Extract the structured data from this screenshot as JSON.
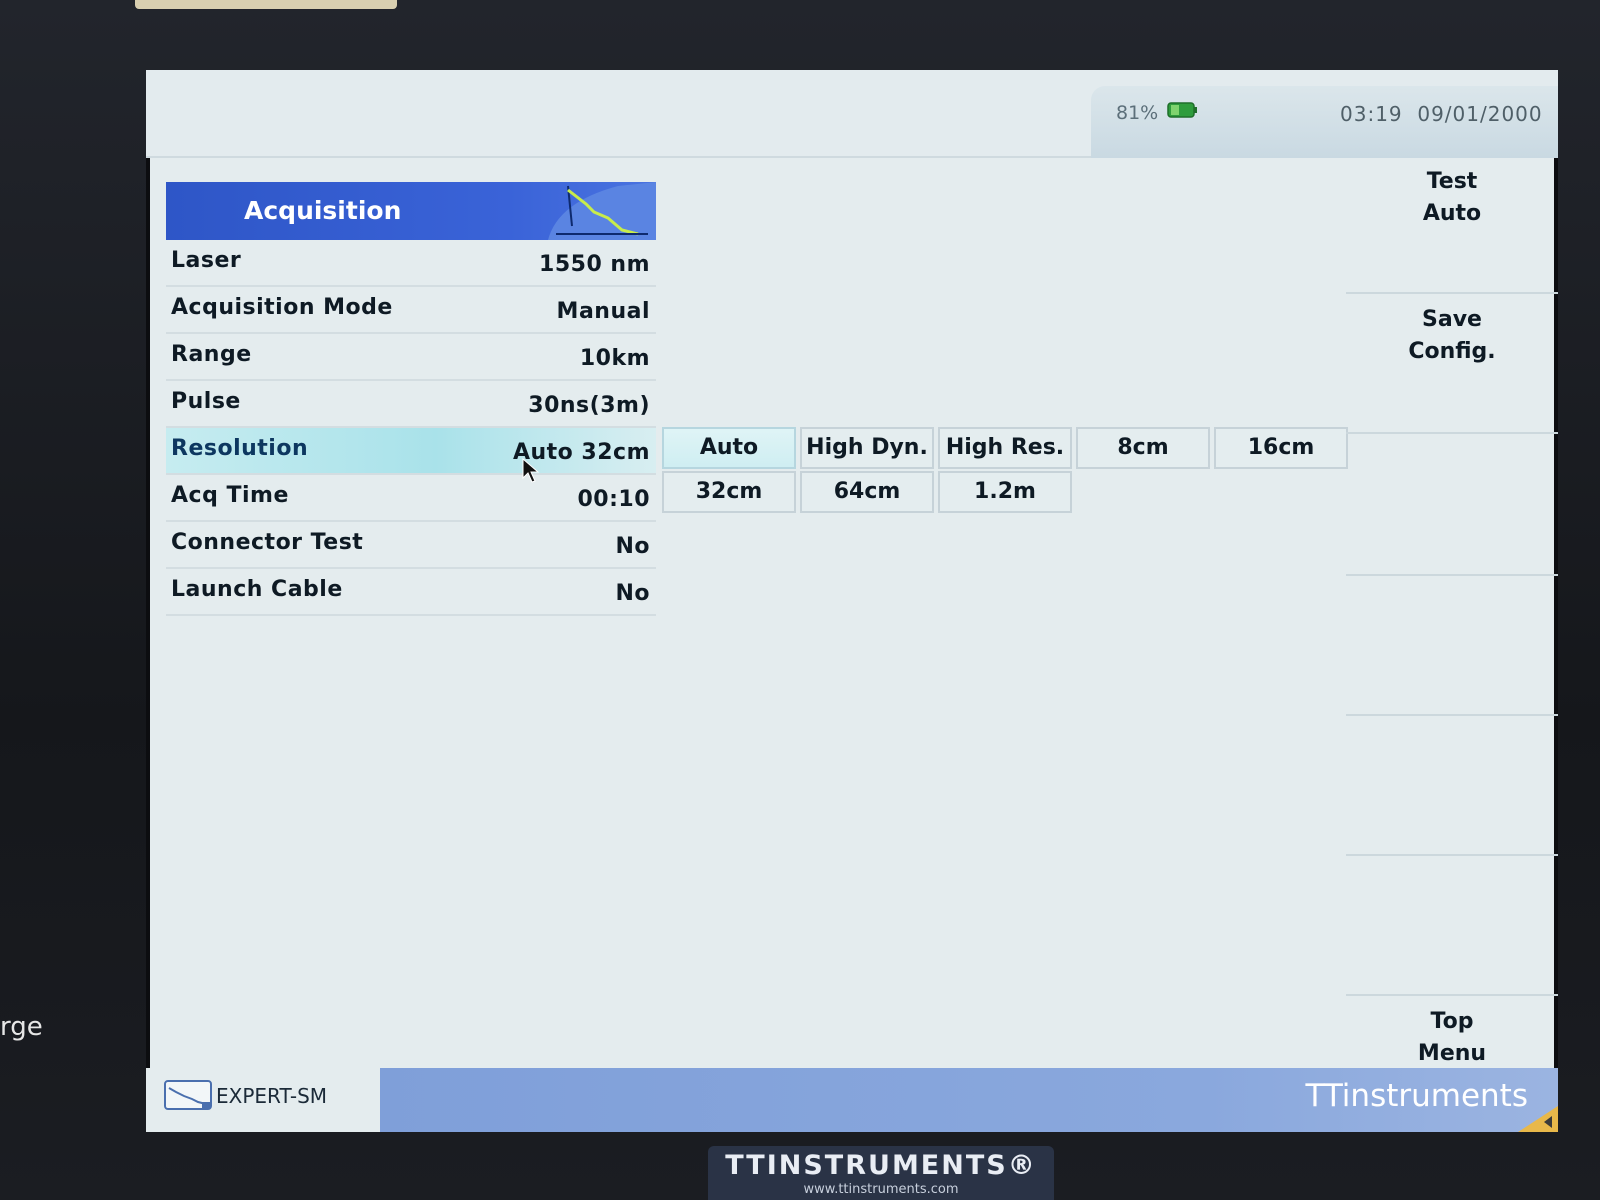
{
  "status": {
    "battery_percent": "81%",
    "time": "03:19",
    "date": "09/01/2000"
  },
  "panel": {
    "title": "Acquisition",
    "rows": [
      {
        "label": "Laser",
        "value": "1550 nm"
      },
      {
        "label": "Acquisition Mode",
        "value": "Manual"
      },
      {
        "label": "Range",
        "value": "10km"
      },
      {
        "label": "Pulse",
        "value": "30ns(3m)"
      },
      {
        "label": "Resolution",
        "value": "Auto 32cm"
      },
      {
        "label": "Acq Time",
        "value": "00:10"
      },
      {
        "label": "Connector Test",
        "value": "No"
      },
      {
        "label": "Launch Cable",
        "value": "No"
      }
    ]
  },
  "resolution_options": [
    "Auto",
    "High Dyn.",
    "High Res.",
    "8cm",
    "16cm",
    "32cm",
    "64cm",
    "1.2m"
  ],
  "softkeys": {
    "test_auto": {
      "line1": "Test",
      "line2": "Auto"
    },
    "save_config": {
      "line1": "Save",
      "line2": "Config."
    },
    "top_menu": {
      "line1": "Top",
      "line2": "Menu"
    }
  },
  "footer": {
    "mode": "EXPERT-SM",
    "brand": "TTinstruments"
  },
  "device": {
    "logo": "TTINSTRUMENTS®",
    "url": "www.ttinstruments.com"
  },
  "bezel": {
    "side_label": "rge"
  },
  "colors": {
    "header_blue": "#3a63d8",
    "selected_row": "#a9e2ea",
    "brand_bar": "#8aa8dd"
  },
  "icons": {
    "battery": "battery-icon",
    "mode": "otdr-trace-icon",
    "cursor": "mouse-pointer-icon"
  }
}
